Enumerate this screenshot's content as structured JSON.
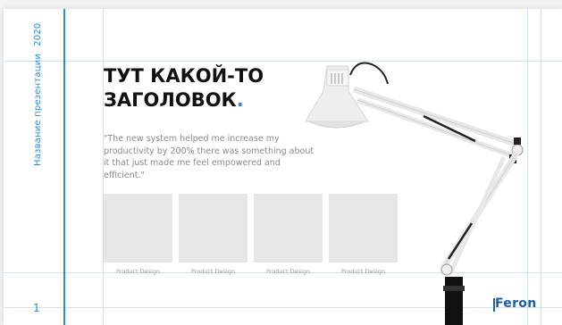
{
  "slide": {
    "side_title": "Название презентации",
    "year": "2020",
    "page_number": "1",
    "heading_line1": "ТУТ КАКОЙ-ТО",
    "heading_line2": "ЗАГОЛОВОК",
    "heading_dot": ".",
    "quote": "\"The new system helped me increase my productivity by 200% there was something about it that just made me feel empowered and efficient.\"",
    "cards": [
      {
        "label": "Product Design"
      },
      {
        "label": "Product Design"
      },
      {
        "label": "Product Design"
      },
      {
        "label": "Product Design"
      }
    ],
    "logo": "Feron"
  },
  "colors": {
    "accent": "#2b8be0",
    "logo": "#1c5ea8",
    "guide": "#cfe3f6",
    "placeholder": "#e6e6e6"
  },
  "icons": {
    "image": "desk-lamp-image"
  }
}
